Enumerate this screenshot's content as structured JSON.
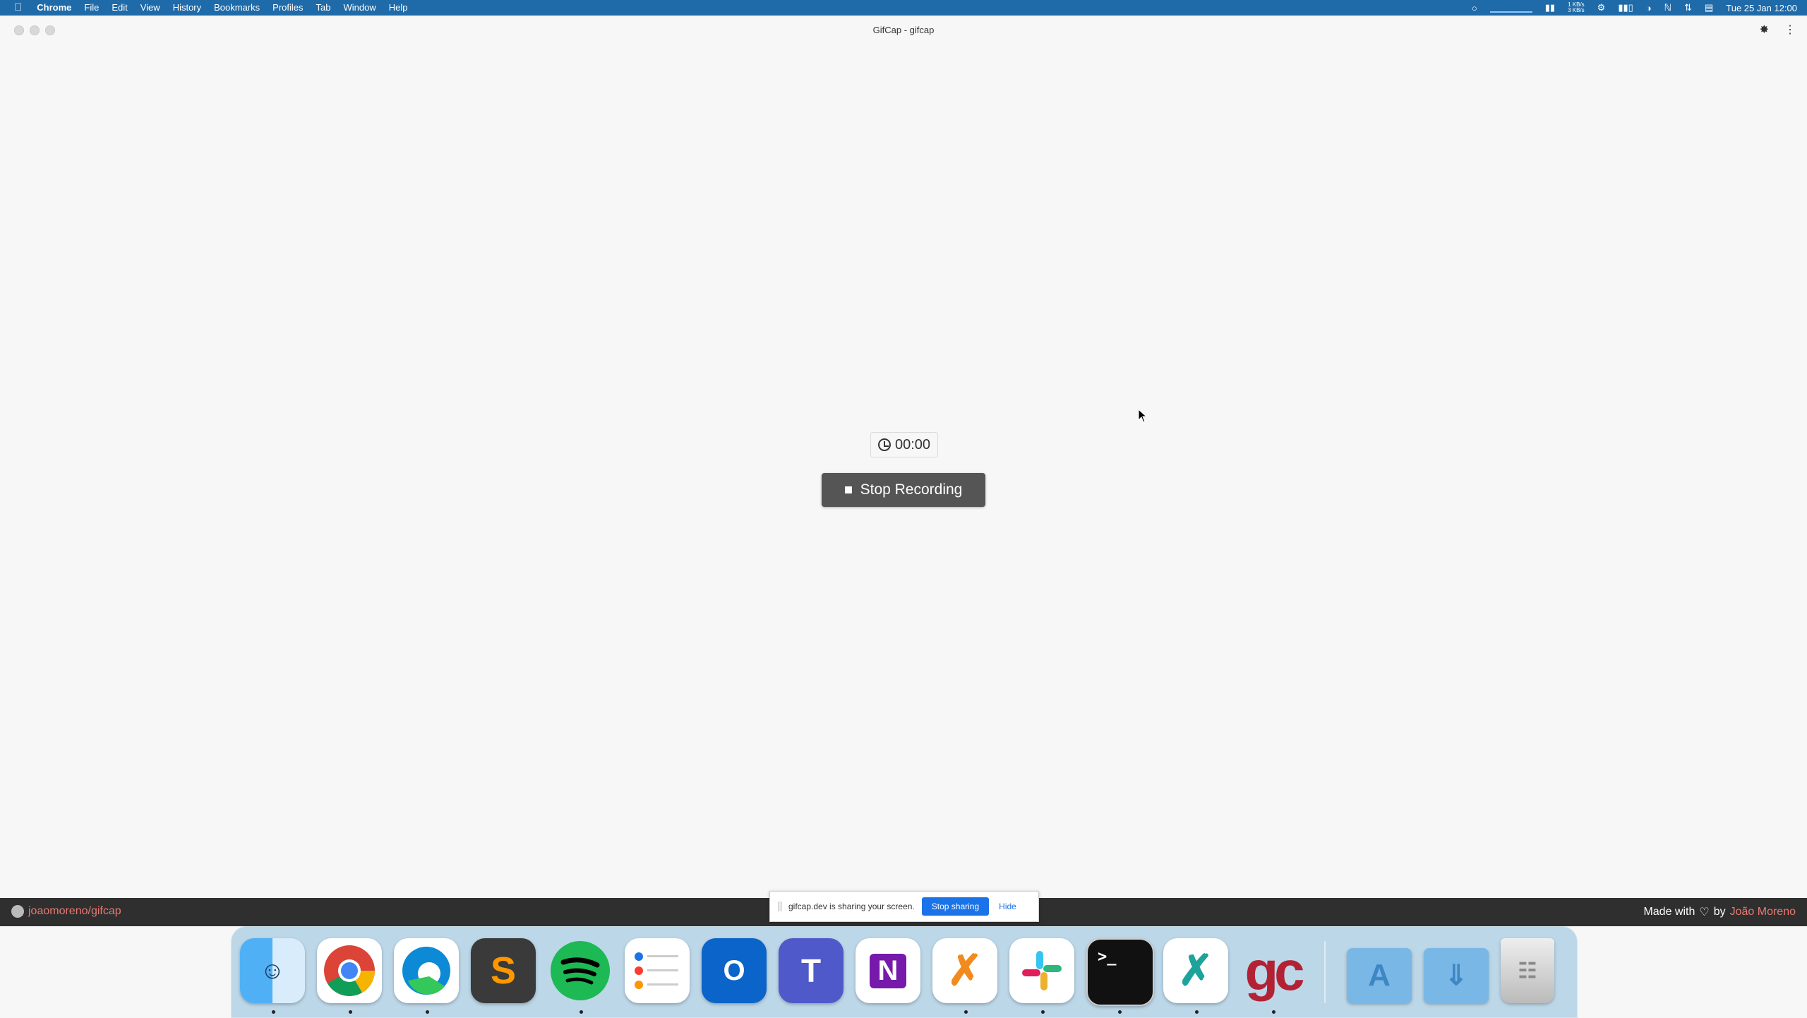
{
  "menubar": {
    "apple": "",
    "items": [
      "Chrome",
      "File",
      "Edit",
      "View",
      "History",
      "Bookmarks",
      "Profiles",
      "Tab",
      "Window",
      "Help"
    ],
    "net_up": "1 KB/s",
    "net_down": "3 KB/s",
    "clock": "Tue 25 Jan  12:00"
  },
  "window": {
    "title": "GifCap - gifcap"
  },
  "recorder": {
    "timer": "00:00",
    "stop_label": "Stop Recording"
  },
  "footer": {
    "repo": "joaomoreno/gifcap",
    "made_with": "Made with",
    "by": "by",
    "author": "João Moreno"
  },
  "share_banner": {
    "message": "gifcap.dev is sharing your screen.",
    "stop_label": "Stop sharing",
    "hide_label": "Hide"
  },
  "dock": {
    "apps": [
      "Finder",
      "Google Chrome",
      "Microsoft Edge",
      "Sublime Text",
      "Spotify",
      "Reminders",
      "Microsoft Outlook",
      "Microsoft Teams",
      "Microsoft OneNote",
      "Visual Studio Code Insiders",
      "Slack",
      "Terminal",
      "Visual Studio Code",
      "GifCap",
      "Applications",
      "Downloads",
      "Trash"
    ],
    "gifcap_letters": "gc",
    "onenote_letter": "N",
    "outlook_letter": "O",
    "terminal_prompt": ">_"
  },
  "colors": {
    "menubar": "#1f6aa8",
    "stop_button": "#555555",
    "footer": "#2f2f2f",
    "link": "#e87a73",
    "share_stop": "#1a73e8"
  }
}
